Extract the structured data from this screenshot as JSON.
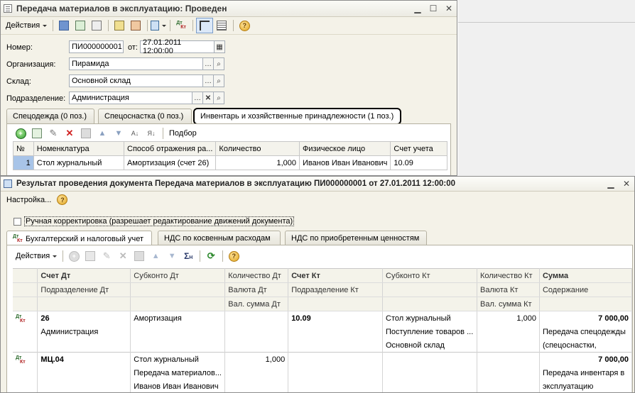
{
  "window1": {
    "title": "Передача материалов в эксплуатацию: Проведен",
    "menu_label": "Действия",
    "fields": {
      "number_label": "Номер:",
      "number_value": "ПИ000000001",
      "date_label": "от:",
      "date_value": "27.01.2011 12:00:00",
      "org_label": "Организация:",
      "org_value": "Пирамида",
      "warehouse_label": "Склад:",
      "warehouse_value": "Основной склад",
      "dept_label": "Подразделение:",
      "dept_value": "Администрация"
    },
    "tabs": [
      "Спецодежда (0 поз.)",
      "Спецоснастка (0 поз.)",
      "Инвентарь и хозяйственные принадлежности (1 поз.)"
    ],
    "active_tab": 2,
    "tab_toolbar": {
      "pick_label": "Подбор"
    },
    "grid": {
      "columns": [
        "№",
        "Номенклатура",
        "Способ отражения ра...",
        "Количество",
        "Физическое лицо",
        "Счет учета"
      ],
      "rows": [
        [
          "1",
          "Стол журнальный",
          "Амортизация (счет 26)",
          "1,000",
          "Иванов Иван Иванович",
          "10.09"
        ]
      ]
    }
  },
  "window2": {
    "title": "Результат проведения документа Передача материалов в эксплуатацию ПИ000000001 от 27.01.2011 12:00:00",
    "settings_label": "Настройка...",
    "manual_checkbox_label": "Ручная корректировка (разрешает редактирование движений документа)",
    "manual_checked": false,
    "tabs": [
      "Бухгалтерский и налоговый учет",
      "НДС по косвенным расходам",
      "НДС по приобретенным ценностям"
    ],
    "active_tab": 0,
    "menu_label": "Действия",
    "grid": {
      "header_rows": [
        [
          "Счет Дт",
          "Субконто Дт",
          "Количество Дт",
          "Счет Кт",
          "Субконто Кт",
          "Количество Кт",
          "Сумма"
        ],
        [
          "Подразделение Дт",
          "",
          "Валюта Дт",
          "Подразделение Кт",
          "",
          "Валюта Кт",
          "Содержание"
        ],
        [
          "",
          "",
          "Вал. сумма Дт",
          "",
          "",
          "Вал. сумма Кт",
          ""
        ]
      ],
      "entries": [
        {
          "rows": [
            [
              "26",
              "Амортизация",
              "",
              "10.09",
              "Стол журнальный",
              "1,000",
              "7 000,00"
            ],
            [
              "Администрация",
              "",
              "",
              "",
              "Поступление товаров ...",
              "",
              "Передача спецодежды"
            ],
            [
              "",
              "",
              "",
              "",
              "Основной склад",
              "",
              "(спецоснастки,"
            ]
          ]
        },
        {
          "rows": [
            [
              "МЦ.04",
              "Стол журнальный",
              "1,000",
              "",
              "",
              "",
              "7 000,00"
            ],
            [
              "",
              "Передача материалов...",
              "",
              "",
              "",
              "",
              "Передача инвентаря в"
            ],
            [
              "",
              "Иванов Иван Иванович",
              "",
              "",
              "",
              "",
              "эксплуатацию"
            ]
          ]
        }
      ]
    }
  },
  "colors": {
    "selection": "#a8c4e8",
    "window_bg": "#f4f2e8",
    "active_tab_outline": "#000000"
  }
}
